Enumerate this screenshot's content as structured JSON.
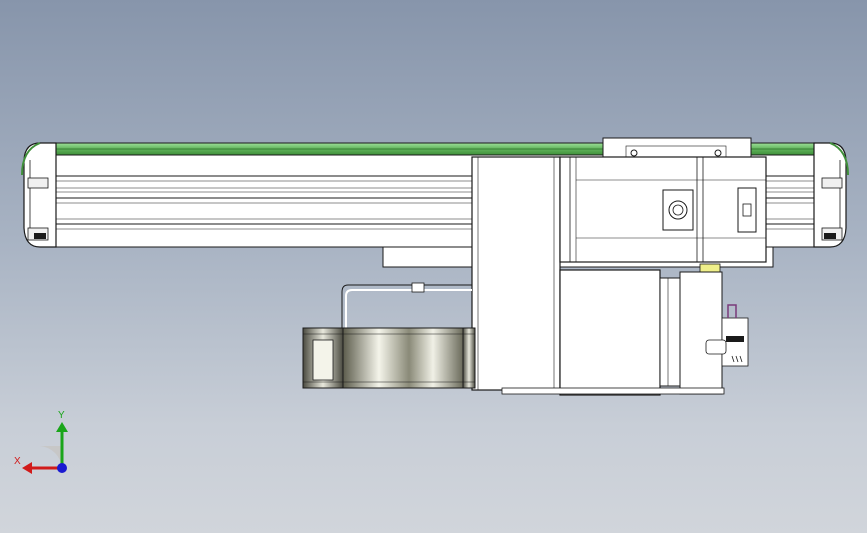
{
  "viewport": {
    "background_top": "#8795ab",
    "background_bottom": "#d1d5db"
  },
  "model": {
    "belt_color": "#6fbf6a",
    "body_color": "#ffffff",
    "outline_color": "#1a1a1a",
    "accent_yellow": "#f0f08a"
  },
  "triad": {
    "x_label": "X",
    "y_label": "Y",
    "x_color": "#d11a1a",
    "y_color": "#1aa51a",
    "z_color": "#1a1ad1"
  }
}
